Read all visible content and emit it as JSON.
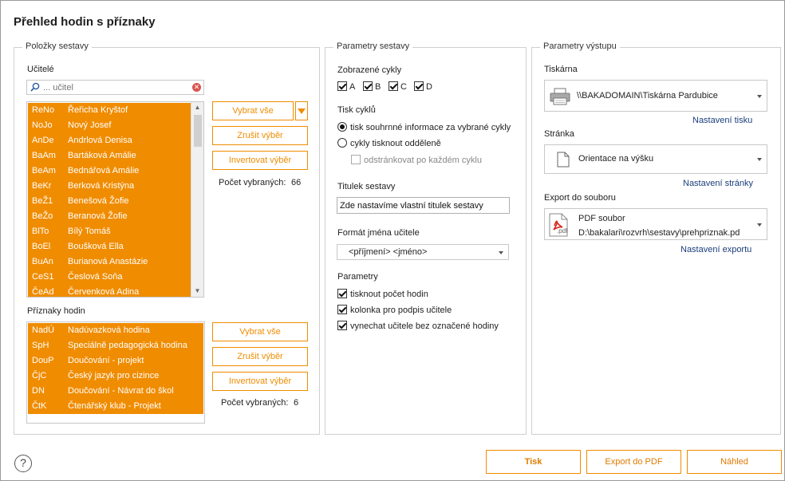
{
  "window": {
    "title": "Přehled hodin s příznaky"
  },
  "items_group": {
    "label": "Položky sestavy",
    "teachers_label": "Učitelé",
    "search_placeholder": "... učitel",
    "teachers": [
      {
        "code": "ReNo",
        "name": "Řeřicha Kryštof"
      },
      {
        "code": "NoJo",
        "name": "Nový Josef"
      },
      {
        "code": "AnDe",
        "name": "Andrlová Denisa"
      },
      {
        "code": "BaAm",
        "name": "Bartáková Amálie"
      },
      {
        "code": "BeAm",
        "name": "Bednářová Amálie"
      },
      {
        "code": "BeKr",
        "name": "Berková Kristýna"
      },
      {
        "code": "BeŽ1",
        "name": "Benešová Žofie"
      },
      {
        "code": "BeŽo",
        "name": "Beranová Žofie"
      },
      {
        "code": "BlTo",
        "name": "Bílý Tomáš"
      },
      {
        "code": "BoEl",
        "name": "Boušková Ella"
      },
      {
        "code": "BuAn",
        "name": "Burianová Anastázie"
      },
      {
        "code": "CeS1",
        "name": "Česlová Soňa"
      },
      {
        "code": "ČeAd",
        "name": "Červenková Adina"
      }
    ],
    "select_all": "Vybrat vše",
    "deselect": "Zrušit výběr",
    "invert": "Invertovat výběr",
    "teachers_count_label": "Počet vybraných:",
    "teachers_count": "66",
    "flags_label": "Příznaky hodin",
    "flags": [
      {
        "code": "NadÚ",
        "name": "Nadúvazková hodina"
      },
      {
        "code": "SpH",
        "name": "Speciálně pedagogická hodina"
      },
      {
        "code": "DouP",
        "name": "Doučování - projekt"
      },
      {
        "code": "ČjC",
        "name": "Český jazyk pro cizince"
      },
      {
        "code": "DN",
        "name": "Doučování - Návrat do škol"
      },
      {
        "code": "ČtK",
        "name": "Čtenářský klub - Projekt"
      }
    ],
    "flags_count_label": "Počet vybraných:",
    "flags_count": "6"
  },
  "params_group": {
    "label": "Parametry sestavy",
    "cycles_label": "Zobrazené cykly",
    "cycles": [
      "A",
      "B",
      "C",
      "D"
    ],
    "print_cycles_label": "Tisk cyklů",
    "radio_summary": "tisk souhrnné informace za vybrané cykly",
    "radio_separate": "cykly tisknout odděleně",
    "page_break": "odstránkovat po každém cyklu",
    "report_title_label": "Titulek sestavy",
    "report_title_value": "Zde nastavíme vlastní titulek sestavy",
    "name_format_label": "Formát jména učitele",
    "name_format_value": "<příjmení> <jméno>",
    "parameters_label": "Parametry",
    "opt_count": "tisknout počet hodin",
    "opt_signature": "kolonka pro podpis učitele",
    "opt_skip": "vynechat učitele bez označené hodiny"
  },
  "output_group": {
    "label": "Parametry výstupu",
    "printer_label": "Tiskárna",
    "printer_value": "\\\\BAKADOMAIN\\Tiskárna Pardubice",
    "printer_settings": "Nastavení tisku",
    "page_label": "Stránka",
    "page_value": "Orientace na výšku",
    "page_settings": "Nastavení stránky",
    "export_label": "Export do souboru",
    "export_value": "PDF soubor",
    "export_path": "D:\\bakalari\\rozvrh\\sestavy\\prehpriznak.pd",
    "export_icon_text": ".pdf",
    "export_settings": "Nastavení exportu"
  },
  "footer": {
    "help": "?",
    "print": "Tisk",
    "export_pdf": "Export do PDF",
    "preview": "Náhled"
  },
  "colors": {
    "accent": "#f08c00",
    "link": "#1a3d7c"
  }
}
